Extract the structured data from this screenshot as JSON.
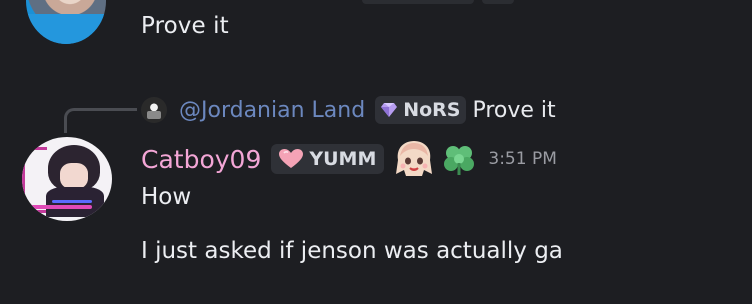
{
  "previous_message": {
    "text": "Prove it"
  },
  "reply": {
    "username": "@Jordanian Land",
    "tag": "NoRS",
    "text": "Prove it"
  },
  "message": {
    "username": "Catboy09",
    "username_color": "#f3a6d6",
    "role_tag": "YUMM",
    "timestamp": "3:51 PM",
    "lines": [
      "How",
      "I just asked if jenson was actually ga"
    ]
  },
  "colors": {
    "background": "#1d1e22",
    "reply_name": "#6c88bf",
    "timestamp": "#9a9ca3"
  },
  "icons": {
    "reply_tag_icon": "purple-gem-icon",
    "role_tag_icon": "pink-heart-icon",
    "emoji_1": "anime-girl-emoji",
    "emoji_2": "green-clover-icon"
  }
}
